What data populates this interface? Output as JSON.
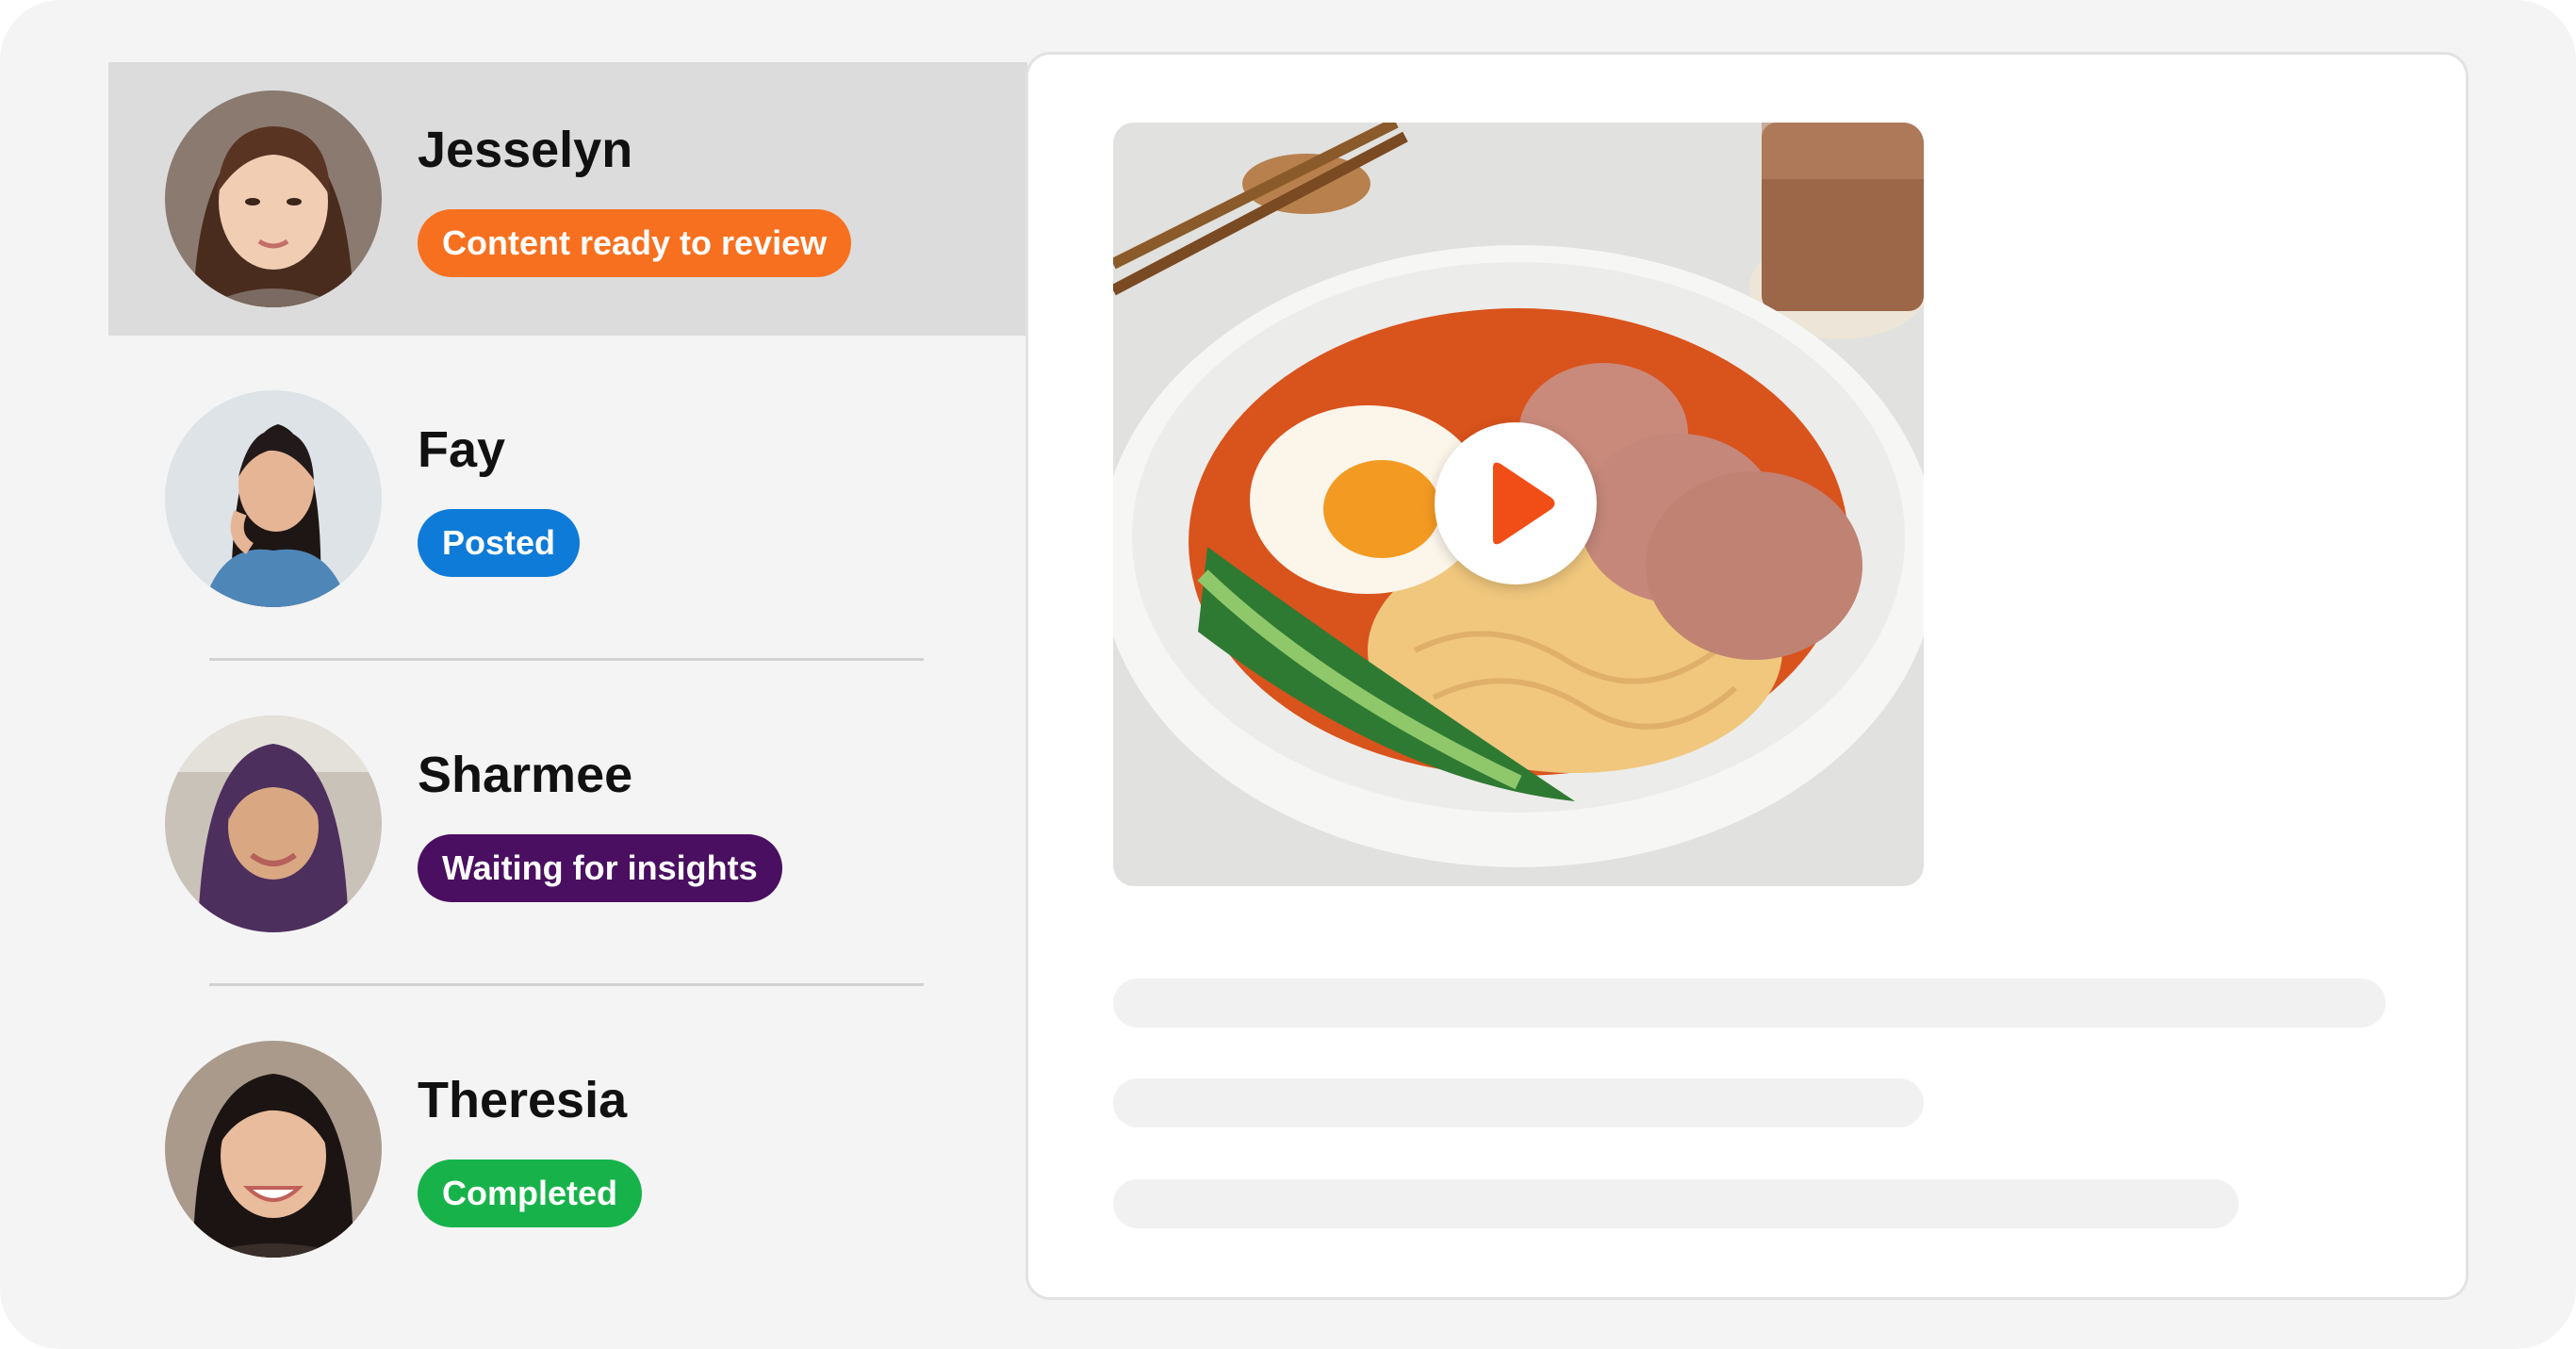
{
  "creators": [
    {
      "name": "Jesselyn",
      "status": "Content ready to review",
      "status_color": "#f7701f"
    },
    {
      "name": "Fay",
      "status": "Posted",
      "status_color": "#0f7bd8"
    },
    {
      "name": "Sharmee",
      "status": "Waiting for insights",
      "status_color": "#4a0f61"
    },
    {
      "name": "Theresia",
      "status": "Completed",
      "status_color": "#17b34a"
    }
  ],
  "preview": {
    "media_type": "video",
    "play_icon": "play-icon",
    "accent_color": "#f04e16"
  },
  "colors": {
    "selected_row": "#dcdcdc",
    "page_background": "#f4f4f4",
    "skeleton": "#f1f1f1"
  }
}
